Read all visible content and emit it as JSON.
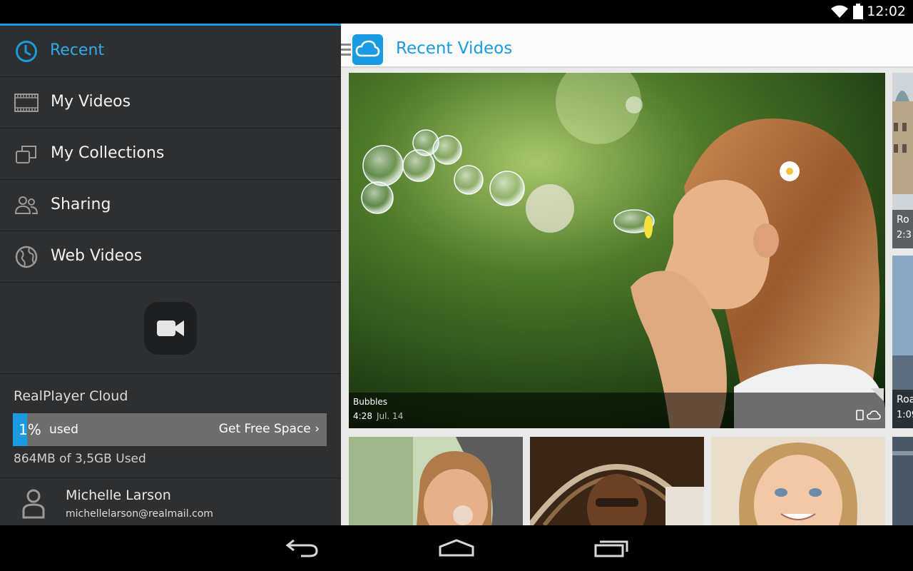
{
  "status_bar": {
    "time": "12:02",
    "icons": [
      "wifi-icon",
      "battery-icon"
    ]
  },
  "drawer": {
    "nav_items": [
      {
        "label": "Recent",
        "icon": "clock-icon",
        "active": true
      },
      {
        "label": "My Videos",
        "icon": "film-strip-icon",
        "active": false
      },
      {
        "label": "My Collections",
        "icon": "collections-icon",
        "active": false
      },
      {
        "label": "Sharing",
        "icon": "people-icon",
        "active": false
      },
      {
        "label": "Web Videos",
        "icon": "globe-icon",
        "active": false
      }
    ],
    "record_button_icon": "video-camera-icon",
    "cloud": {
      "title": "RealPlayer Cloud",
      "percent_used": 1,
      "percent_label": "1%",
      "used_label": "used",
      "get_space_label": "Get Free Space",
      "detail": "864MB of 3,5GB Used"
    },
    "user": {
      "name": "Michelle Larson",
      "email": "michellelarson@realmail.com",
      "icon": "user-icon"
    }
  },
  "main": {
    "app_icon": "cloud-icon",
    "title": "Recent Videos",
    "featured": {
      "title": "Bubbles",
      "duration": "4:28",
      "date": "Jul. 14",
      "icons": [
        "device-icon",
        "cloud-sync-icon"
      ]
    },
    "side_tiles": [
      {
        "title": "Ro",
        "duration": "2:3"
      },
      {
        "title": "Roa",
        "duration": "1:09"
      }
    ],
    "thumbnails": [
      "bubbles-woman",
      "man-sunglasses",
      "smiling-girl",
      "partial"
    ]
  },
  "navbar": {
    "icons": [
      "back-icon",
      "home-icon",
      "recent-apps-icon"
    ]
  },
  "colors": {
    "accent": "#1a9ae0",
    "drawer_bg": "#2e2f30",
    "main_bg": "#e9e9e9"
  }
}
